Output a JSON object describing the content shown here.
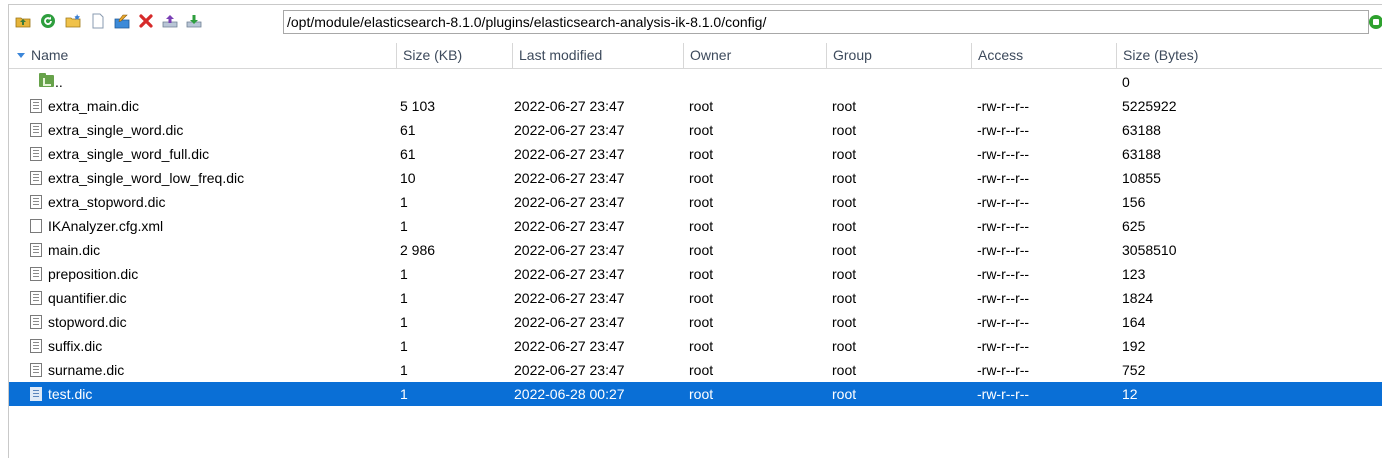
{
  "toolbar": {
    "icons": [
      "home-folder-icon",
      "refresh-icon",
      "new-folder-icon",
      "new-file-icon",
      "edit-icon",
      "delete-icon",
      "upload-icon",
      "download-icon"
    ],
    "path": "/opt/module/elasticsearch-8.1.0/plugins/elasticsearch-analysis-ik-8.1.0/config/"
  },
  "columns": {
    "name": "Name",
    "size_kb": "Size (KB)",
    "modified": "Last modified",
    "owner": "Owner",
    "group": "Group",
    "access": "Access",
    "size_bytes": "Size (Bytes)"
  },
  "parent": {
    "name": "..",
    "size_bytes": "0"
  },
  "files": [
    {
      "name": "extra_main.dic",
      "size_kb": "5 103",
      "modified": "2022-06-27 23:47",
      "owner": "root",
      "group": "root",
      "access": "-rw-r--r--",
      "size_bytes": "5225922",
      "icon": "doc"
    },
    {
      "name": "extra_single_word.dic",
      "size_kb": "61",
      "modified": "2022-06-27 23:47",
      "owner": "root",
      "group": "root",
      "access": "-rw-r--r--",
      "size_bytes": "63188",
      "icon": "doc"
    },
    {
      "name": "extra_single_word_full.dic",
      "size_kb": "61",
      "modified": "2022-06-27 23:47",
      "owner": "root",
      "group": "root",
      "access": "-rw-r--r--",
      "size_bytes": "63188",
      "icon": "doc"
    },
    {
      "name": "extra_single_word_low_freq.dic",
      "size_kb": "10",
      "modified": "2022-06-27 23:47",
      "owner": "root",
      "group": "root",
      "access": "-rw-r--r--",
      "size_bytes": "10855",
      "icon": "doc"
    },
    {
      "name": "extra_stopword.dic",
      "size_kb": "1",
      "modified": "2022-06-27 23:47",
      "owner": "root",
      "group": "root",
      "access": "-rw-r--r--",
      "size_bytes": "156",
      "icon": "doc"
    },
    {
      "name": "IKAnalyzer.cfg.xml",
      "size_kb": "1",
      "modified": "2022-06-27 23:47",
      "owner": "root",
      "group": "root",
      "access": "-rw-r--r--",
      "size_bytes": "625",
      "icon": "blank"
    },
    {
      "name": "main.dic",
      "size_kb": "2 986",
      "modified": "2022-06-27 23:47",
      "owner": "root",
      "group": "root",
      "access": "-rw-r--r--",
      "size_bytes": "3058510",
      "icon": "doc"
    },
    {
      "name": "preposition.dic",
      "size_kb": "1",
      "modified": "2022-06-27 23:47",
      "owner": "root",
      "group": "root",
      "access": "-rw-r--r--",
      "size_bytes": "123",
      "icon": "doc"
    },
    {
      "name": "quantifier.dic",
      "size_kb": "1",
      "modified": "2022-06-27 23:47",
      "owner": "root",
      "group": "root",
      "access": "-rw-r--r--",
      "size_bytes": "1824",
      "icon": "doc"
    },
    {
      "name": "stopword.dic",
      "size_kb": "1",
      "modified": "2022-06-27 23:47",
      "owner": "root",
      "group": "root",
      "access": "-rw-r--r--",
      "size_bytes": "164",
      "icon": "doc"
    },
    {
      "name": "suffix.dic",
      "size_kb": "1",
      "modified": "2022-06-27 23:47",
      "owner": "root",
      "group": "root",
      "access": "-rw-r--r--",
      "size_bytes": "192",
      "icon": "doc"
    },
    {
      "name": "surname.dic",
      "size_kb": "1",
      "modified": "2022-06-27 23:47",
      "owner": "root",
      "group": "root",
      "access": "-rw-r--r--",
      "size_bytes": "752",
      "icon": "doc"
    },
    {
      "name": "test.dic",
      "size_kb": "1",
      "modified": "2022-06-28 00:27",
      "owner": "root",
      "group": "root",
      "access": "-rw-r--r--",
      "size_bytes": "12",
      "icon": "doc",
      "selected": true
    }
  ],
  "colors": {
    "selection": "#0a6fd6",
    "header_text": "#3d4a5c",
    "sort_arrow": "#3b86d9"
  }
}
